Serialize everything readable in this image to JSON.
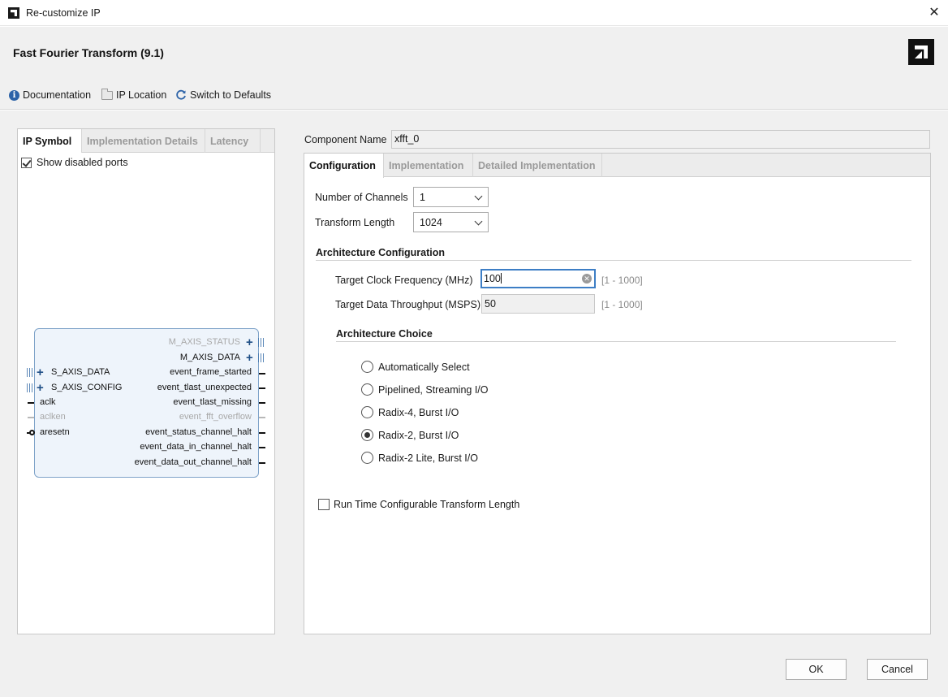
{
  "window": {
    "title": "Re-customize IP",
    "close_glyph": "✕"
  },
  "header": {
    "ip_title": "Fast Fourier Transform (9.1)",
    "toolbar": {
      "documentation": "Documentation",
      "ip_location": "IP Location",
      "switch_defaults": "Switch to Defaults"
    }
  },
  "left": {
    "tabs": [
      "IP Symbol",
      "Implementation Details",
      "Latency"
    ],
    "show_disabled_ports": "Show disabled ports",
    "symbol": {
      "left_ports": [
        "S_AXIS_DATA",
        "S_AXIS_CONFIG",
        "aclk",
        "aclken",
        "aresetn"
      ],
      "right_ports": [
        "M_AXIS_STATUS",
        "M_AXIS_DATA",
        "event_frame_started",
        "event_tlast_unexpected",
        "event_tlast_missing",
        "event_fft_overflow",
        "event_status_channel_halt",
        "event_data_in_channel_halt",
        "event_data_out_channel_halt"
      ]
    }
  },
  "right": {
    "component_name_label": "Component Name",
    "component_name": "xfft_0",
    "tabs": [
      "Configuration",
      "Implementation",
      "Detailed Implementation"
    ],
    "channels_label": "Number of Channels",
    "channels_value": "1",
    "transform_label": "Transform Length",
    "transform_value": "1024",
    "arch_config_title": "Architecture Configuration",
    "clock_label": "Target Clock Frequency (MHz)",
    "clock_value": "100",
    "clock_range": "[1 - 1000]",
    "throughput_label": "Target Data Throughput (MSPS)",
    "throughput_value": "50",
    "throughput_range": "[1 - 1000]",
    "arch_choice_title": "Architecture Choice",
    "arch_options": [
      "Automatically Select",
      "Pipelined, Streaming I/O",
      "Radix-4, Burst I/O",
      "Radix-2, Burst I/O",
      "Radix-2 Lite, Burst I/O"
    ],
    "arch_selected": "Radix-2, Burst I/O",
    "runtime_config_label": "Run Time Configurable Transform Length"
  },
  "buttons": {
    "ok": "OK",
    "cancel": "Cancel"
  }
}
